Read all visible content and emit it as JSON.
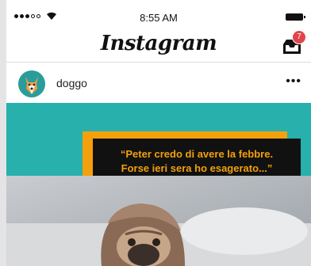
{
  "status_bar": {
    "time": "8:55 AM"
  },
  "nav": {
    "logo": "Instagram",
    "inbox_badge": "7"
  },
  "post": {
    "username": "doggo",
    "more": "•••",
    "caption_line1": "“Peter credo di avere la febbre.",
    "caption_line2": "Forse ieri sera ho esagerato...”"
  },
  "colors": {
    "teal": "#27b0ac",
    "orange": "#f3a00c",
    "badge": "#e0454c"
  },
  "icons": [
    "signal-dots-icon",
    "wifi-icon",
    "battery-icon",
    "inbox-tray-icon",
    "more-options-icon",
    "dog-avatar"
  ]
}
